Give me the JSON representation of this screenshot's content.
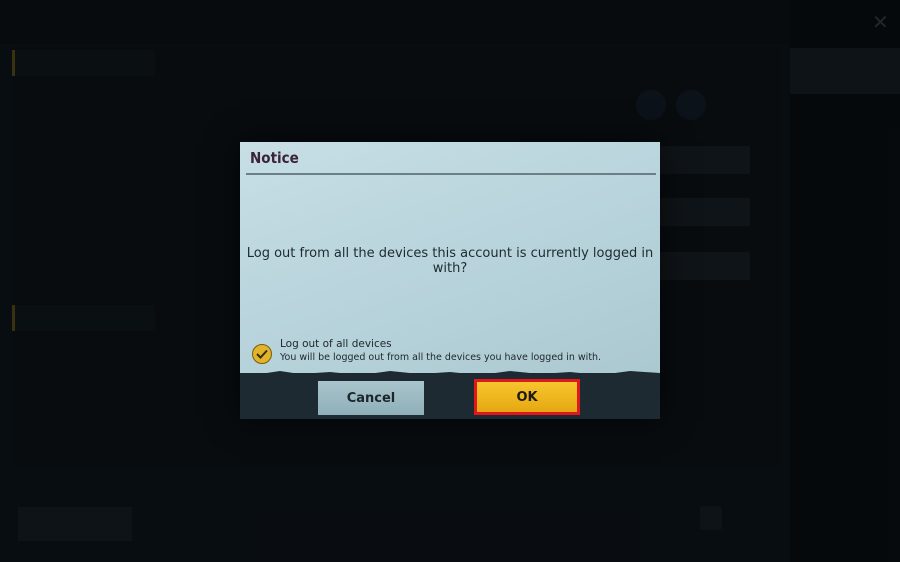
{
  "notice": {
    "title": "Notice",
    "message": "Log out from all the devices this account is currently logged in with?",
    "option_title": "Log out of all devices",
    "option_description": "You will be logged out from all the devices you have logged in with.",
    "option_checked": true,
    "cancel_label": "Cancel",
    "ok_label": "OK"
  },
  "colors": {
    "dialog_bg": "#bad5dd",
    "ok_button": "#f2bb22",
    "ok_highlight_border": "#e0171d",
    "cancel_button": "#9dbac3",
    "footer": "#1d2a31",
    "title_text": "#3a2436"
  },
  "icons": {
    "option_icon": "checkmark-circle-icon",
    "close_icon": "close-x-icon"
  }
}
